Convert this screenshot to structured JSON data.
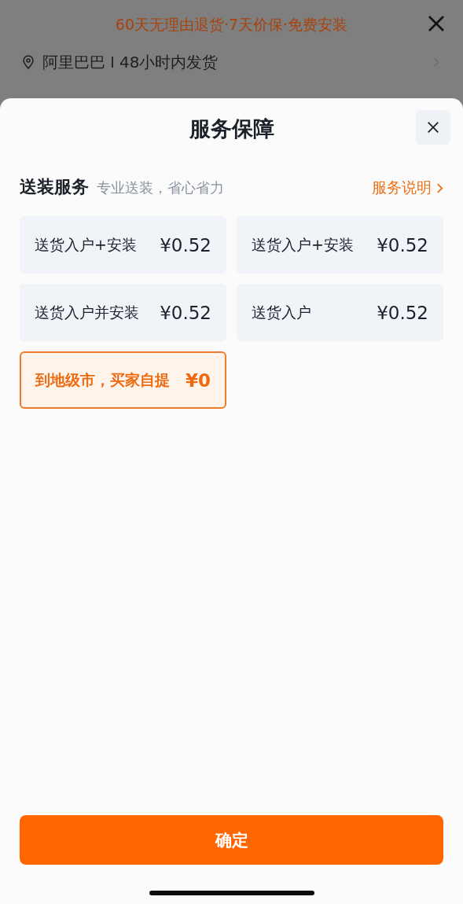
{
  "background_page": {
    "promo": "60天无理由退货·7天价保·免费安装",
    "shop": "阿里巴巴",
    "shipping": "48小时内发货"
  },
  "sheet": {
    "title": "服务保障",
    "section": {
      "title": "送装服务",
      "subtitle": "专业送装，省心省力",
      "link": "服务说明"
    },
    "options": [
      {
        "label": "送货入户+安装",
        "price": "¥0.52",
        "selected": false
      },
      {
        "label": "送货入户+安装",
        "price": "¥0.52",
        "selected": false
      },
      {
        "label": "送货入户并安装",
        "price": "¥0.52",
        "selected": false
      },
      {
        "label": "送货入户",
        "price": "¥0.52",
        "selected": false
      },
      {
        "label": "到地级市，买家自提",
        "price": "¥0",
        "selected": true
      }
    ],
    "confirm": "确定"
  }
}
